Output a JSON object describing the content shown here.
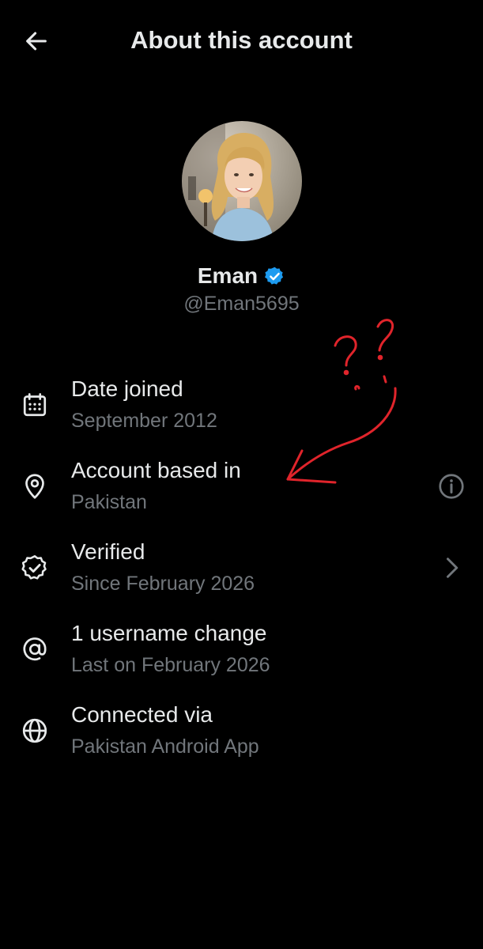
{
  "header": {
    "title": "About this account",
    "back_icon": "arrow-left-icon"
  },
  "profile": {
    "name": "Eman",
    "handle": "@Eman5695",
    "verified_badge_color": "#1d9bf0"
  },
  "info": [
    {
      "icon": "calendar-icon",
      "title": "Date joined",
      "subtitle": "September 2012",
      "trailing": null
    },
    {
      "icon": "location-pin-icon",
      "title": "Account based in",
      "subtitle": "Pakistan",
      "trailing": "info-icon"
    },
    {
      "icon": "verified-badge-outline-icon",
      "title": "Verified",
      "subtitle": "Since February 2026",
      "trailing": "chevron-right-icon"
    },
    {
      "icon": "at-sign-icon",
      "title": "1 username change",
      "subtitle": "Last on February 2026",
      "trailing": null
    },
    {
      "icon": "globe-icon",
      "title": "Connected via",
      "subtitle": "Pakistan Android App",
      "trailing": null
    }
  ],
  "annotation": {
    "text": "??",
    "color": "#e0242b"
  }
}
